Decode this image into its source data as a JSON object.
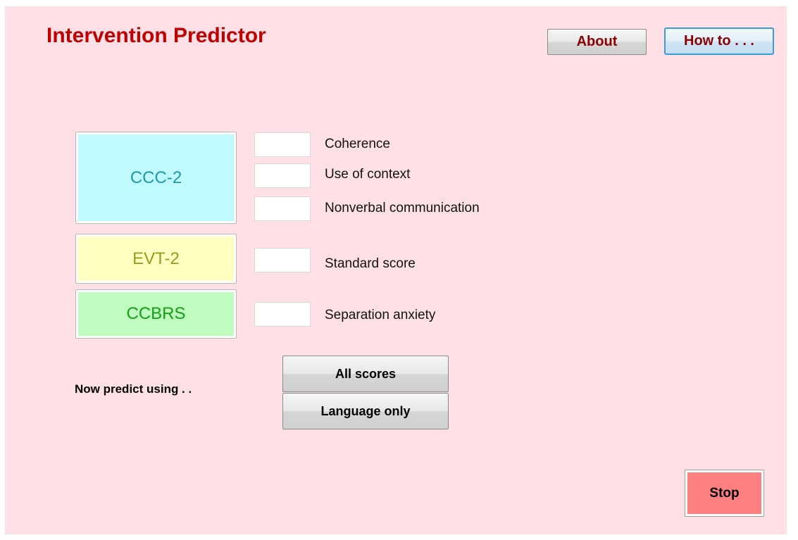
{
  "app": {
    "title": "Intervention Predictor"
  },
  "header": {
    "about_label": "About",
    "howto_label": "How to . . ."
  },
  "blocks": {
    "ccc": {
      "label": "CCC-2",
      "fields": [
        {
          "label": "Coherence",
          "value": ""
        },
        {
          "label": "Use of context",
          "value": ""
        },
        {
          "label": "Nonverbal communication",
          "value": ""
        }
      ]
    },
    "evt": {
      "label": "EVT-2",
      "fields": [
        {
          "label": "Standard score",
          "value": ""
        }
      ]
    },
    "ccbrs": {
      "label": "CCBRS",
      "fields": [
        {
          "label": "Separation anxiety",
          "value": ""
        }
      ]
    }
  },
  "predict": {
    "label": "Now predict using . .",
    "all_scores_label": "All scores",
    "language_only_label": "Language only"
  },
  "stop_label": "Stop",
  "colors": {
    "background": "#ffe0e6",
    "title": "#c00000",
    "ccc_fill": "#c0fafe",
    "evt_fill": "#fffec0",
    "ccbrs_fill": "#c0fcc0",
    "stop_fill": "#ff8080"
  }
}
